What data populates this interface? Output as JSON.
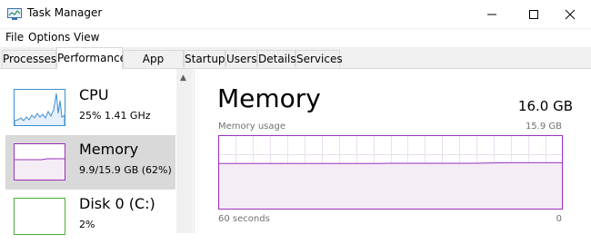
{
  "window": {
    "title": "Task Manager"
  },
  "menu": {
    "items": [
      "File",
      "Options",
      "View"
    ]
  },
  "tabs": [
    "Processes",
    "Performance",
    "App history",
    "Startup",
    "Users",
    "Details",
    "Services"
  ],
  "active_tab": "Performance",
  "sidebar": {
    "items": [
      {
        "name": "CPU",
        "detail": "25%  1.41 GHz",
        "color": "#3c8fcf"
      },
      {
        "name": "Memory",
        "detail": "9.9/15.9 GB (62%)",
        "color": "#9b30b8",
        "selected": true
      },
      {
        "name": "Disk 0 (C:)",
        "detail": "2%",
        "color": "#4caa3c"
      }
    ]
  },
  "main": {
    "title": "Memory",
    "total": "16.0 GB",
    "usage_label": "Memory usage",
    "usage_max": "15.9 GB",
    "axis_left": "60 seconds",
    "axis_right": "0",
    "graph_color": "#9b30b8",
    "graph_fill": "#f4edf6"
  },
  "chart_data": {
    "type": "area",
    "ylabel": "Memory usage",
    "ylim": [
      0,
      15.9
    ],
    "xlim": [
      60,
      0
    ],
    "x": [
      60,
      40,
      32,
      30,
      20,
      15,
      10,
      5,
      0
    ],
    "values": [
      9.85,
      9.85,
      9.85,
      9.9,
      9.9,
      9.9,
      10.0,
      10.0,
      10.0
    ]
  }
}
